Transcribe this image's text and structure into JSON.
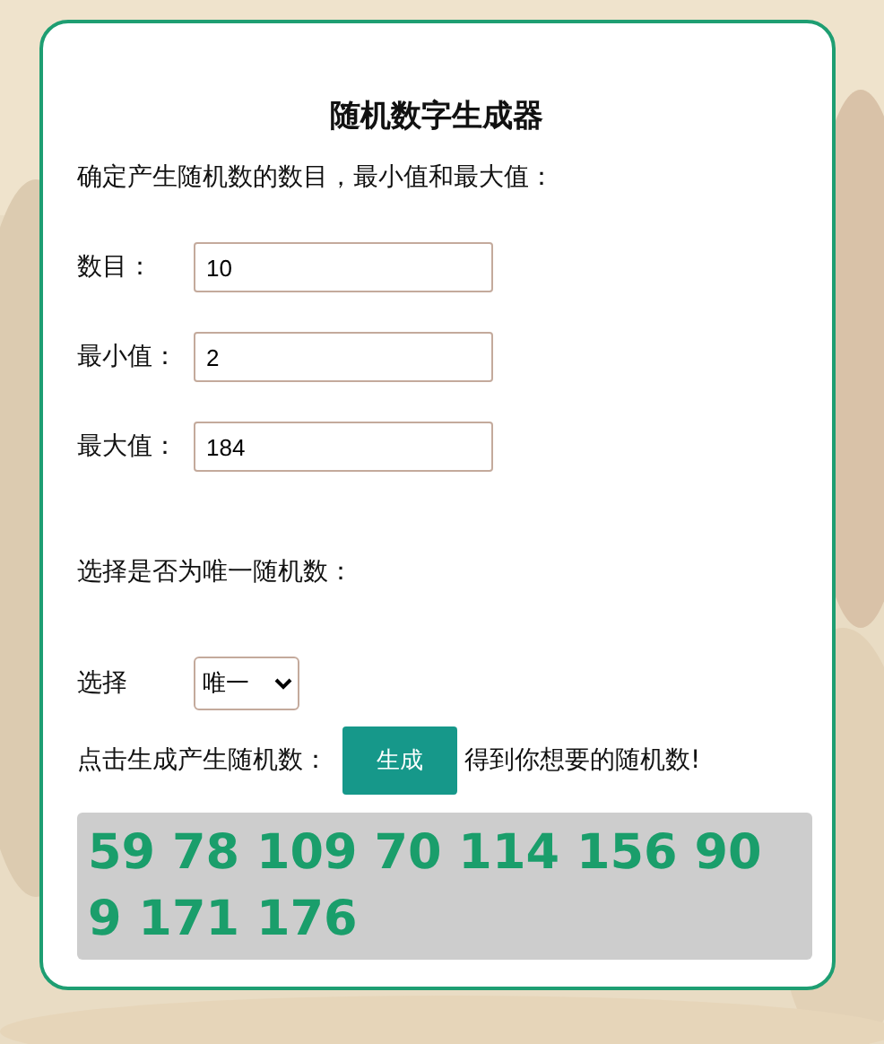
{
  "title": "随机数字生成器",
  "intro": "确定产生随机数的数目，最小值和最大值：",
  "fields": [
    {
      "label": "数目：",
      "value": "10"
    },
    {
      "label": "最小值：",
      "value": "2"
    },
    {
      "label": "最大值：",
      "value": "184"
    }
  ],
  "unique_prompt": "选择是否为唯一随机数：",
  "select": {
    "label": "选择",
    "value": "唯一"
  },
  "generate": {
    "before": "点击生成产生随机数：",
    "button": "生成",
    "after": "得到你想要的随机数!"
  },
  "result": "59 78 109 70 114 156 90 9 171 176"
}
